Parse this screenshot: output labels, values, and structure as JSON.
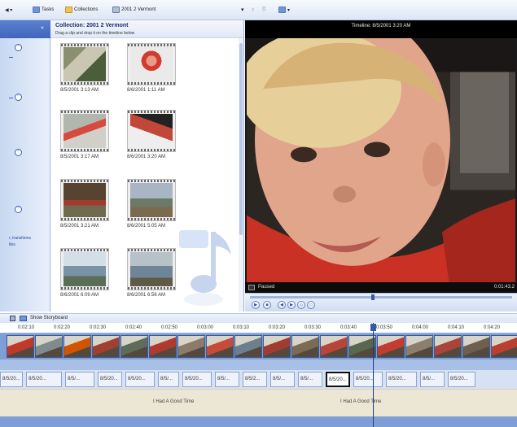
{
  "toolbar": {
    "tasks_label": "Tasks",
    "collections_label": "Collections",
    "collection_dropdown": "2001 2 Vermont"
  },
  "taskpane": {
    "link1": "r, transitions",
    "link2": "tles"
  },
  "collection": {
    "title": "Collection: 2001 2 Vermont",
    "subtitle": "Drag a clip and drop it on the timeline below",
    "clips": [
      {
        "label": "8/5/2001 3:13 AM"
      },
      {
        "label": "8/6/2001 1:11 AM"
      },
      {
        "label": "8/5/2001 3:17 AM"
      },
      {
        "label": "8/6/2001 3:20 AM"
      },
      {
        "label": "8/5/2001 3:21 AM"
      },
      {
        "label": "8/6/2001 5:05 AM"
      },
      {
        "label": "8/6/2001 6:09 AM"
      },
      {
        "label": "8/6/2001 6:56 AM"
      }
    ]
  },
  "monitor": {
    "title": "Timeline: 8/5/2001 3:20 AM",
    "status": "Paused",
    "time": "0:01:43.2",
    "seek_fraction": 0.47
  },
  "storyboard": {
    "show_label": "Show Storyboard"
  },
  "timeline": {
    "ticks": [
      "0:02:10",
      "0:02:20",
      "0:02:30",
      "0:02:40",
      "0:02:50",
      "0:03:00",
      "0:03:10",
      "0:03:20",
      "0:03:30",
      "0:03:40",
      "0:03:50",
      "0:04:00",
      "0:04:10",
      "0:04:20"
    ],
    "labels": [
      "8/5/20...",
      "8/5/20...",
      "8/5/...",
      "8/5/20...",
      "8/5/20...",
      "8/5/...",
      "8/5/20...",
      "8/5/...",
      "8/5/2...",
      "8/5/...",
      "8/5/...",
      "8/5/20...",
      "8/5/20...",
      "8/5/20...",
      "8/5/...",
      "8/5/20..."
    ],
    "audio_name_1": "I Had A Good Time",
    "audio_name_2": "I Had A Good Time"
  }
}
